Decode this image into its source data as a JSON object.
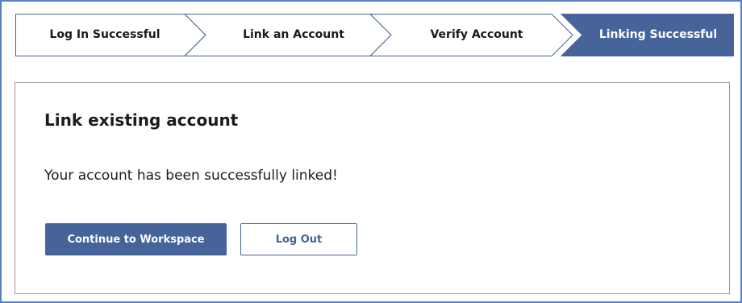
{
  "stepper": {
    "steps": [
      {
        "label": "Log In Successful",
        "state": "complete"
      },
      {
        "label": "Link an Account",
        "state": "complete"
      },
      {
        "label": "Verify Account",
        "state": "complete"
      },
      {
        "label": "Linking Successful",
        "state": "current"
      }
    ],
    "active_color": "#46639a",
    "inactive_color": "#ffffff",
    "border_color": "#46639a"
  },
  "card": {
    "title": "Link existing account",
    "message": "Your account has been successfully linked!"
  },
  "actions": {
    "continue_label": "Continue to Workspace",
    "logout_label": "Log Out"
  }
}
